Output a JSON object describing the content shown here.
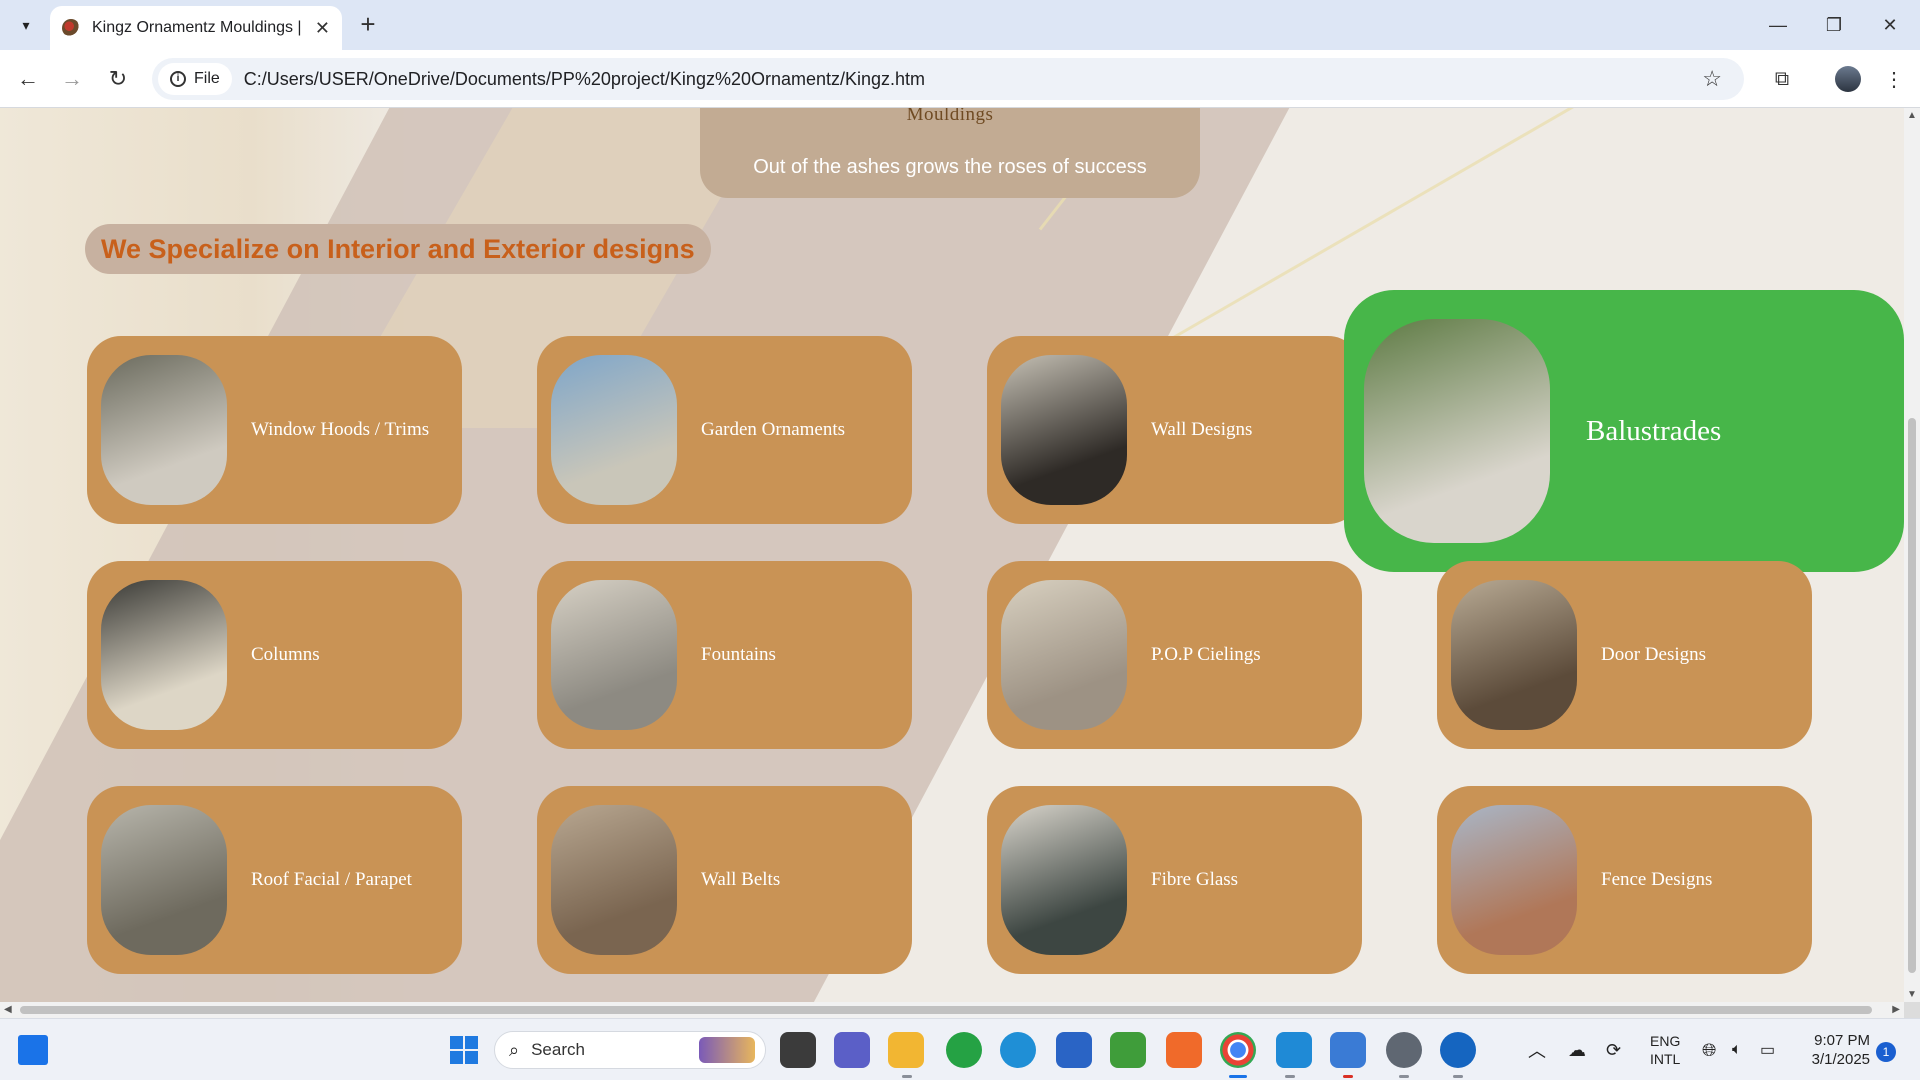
{
  "browser": {
    "tab_title": "Kingz Ornamentz Mouldings | y",
    "tab_close": "✕",
    "new_tab": "+",
    "chip_label": "File",
    "url": "C:/Users/USER/OneDrive/Documents/PP%20project/Kingz%20Ornamentz/Kingz.htm"
  },
  "hero": {
    "logo_text": "Mouldings",
    "tagline": "Out of the ashes grows the roses of success"
  },
  "section": {
    "heading": "We Specialize on Interior and Exterior designs"
  },
  "cards": [
    {
      "label": "Window Hoods / Trims",
      "image": "window-photo",
      "colors": [
        "#6b6b5e",
        "#cfcac0"
      ]
    },
    {
      "label": "Garden Ornaments",
      "image": "garden-photo",
      "colors": [
        "#7fa6c9",
        "#c9c6b9"
      ]
    },
    {
      "label": "Wall Designs",
      "image": "wall-photo",
      "colors": [
        "#c5c0b4",
        "#2e2a26"
      ]
    },
    {
      "label": "Balustrades",
      "image": "balustrade-photo",
      "colors": [
        "#5e7b44",
        "#d9d5cc"
      ],
      "hovered": true
    },
    {
      "label": "Columns",
      "image": "columns-photo",
      "colors": [
        "#3a3a36",
        "#ddd6c6"
      ]
    },
    {
      "label": "Fountains",
      "image": "fountain-photo",
      "colors": [
        "#d6d0c4",
        "#8d8a82"
      ]
    },
    {
      "label": "P.O.P Cielings",
      "image": "ceiling-photo",
      "colors": [
        "#d8d0c0",
        "#9d9284"
      ]
    },
    {
      "label": "Door Designs",
      "image": "door-photo",
      "colors": [
        "#b8aa94",
        "#5c4b3a"
      ]
    },
    {
      "label": "Roof Facial / Parapet",
      "image": "roof-photo",
      "colors": [
        "#b7b5ab",
        "#6e6a5e"
      ]
    },
    {
      "label": "Wall Belts",
      "image": "wall-belt-photo",
      "colors": [
        "#b8a791",
        "#7a6550"
      ]
    },
    {
      "label": "Fibre Glass",
      "image": "fibreglass-photo",
      "colors": [
        "#d8d4cb",
        "#3d4642"
      ]
    },
    {
      "label": "Fence Designs",
      "image": "fence-photo",
      "colors": [
        "#a9b6c7",
        "#b07758"
      ]
    }
  ],
  "taskbar": {
    "search_label": "Search",
    "lang_top": "ENG",
    "lang_bottom": "INTL",
    "time": "9:07 PM",
    "date": "3/1/2025",
    "notification_count": "1"
  }
}
